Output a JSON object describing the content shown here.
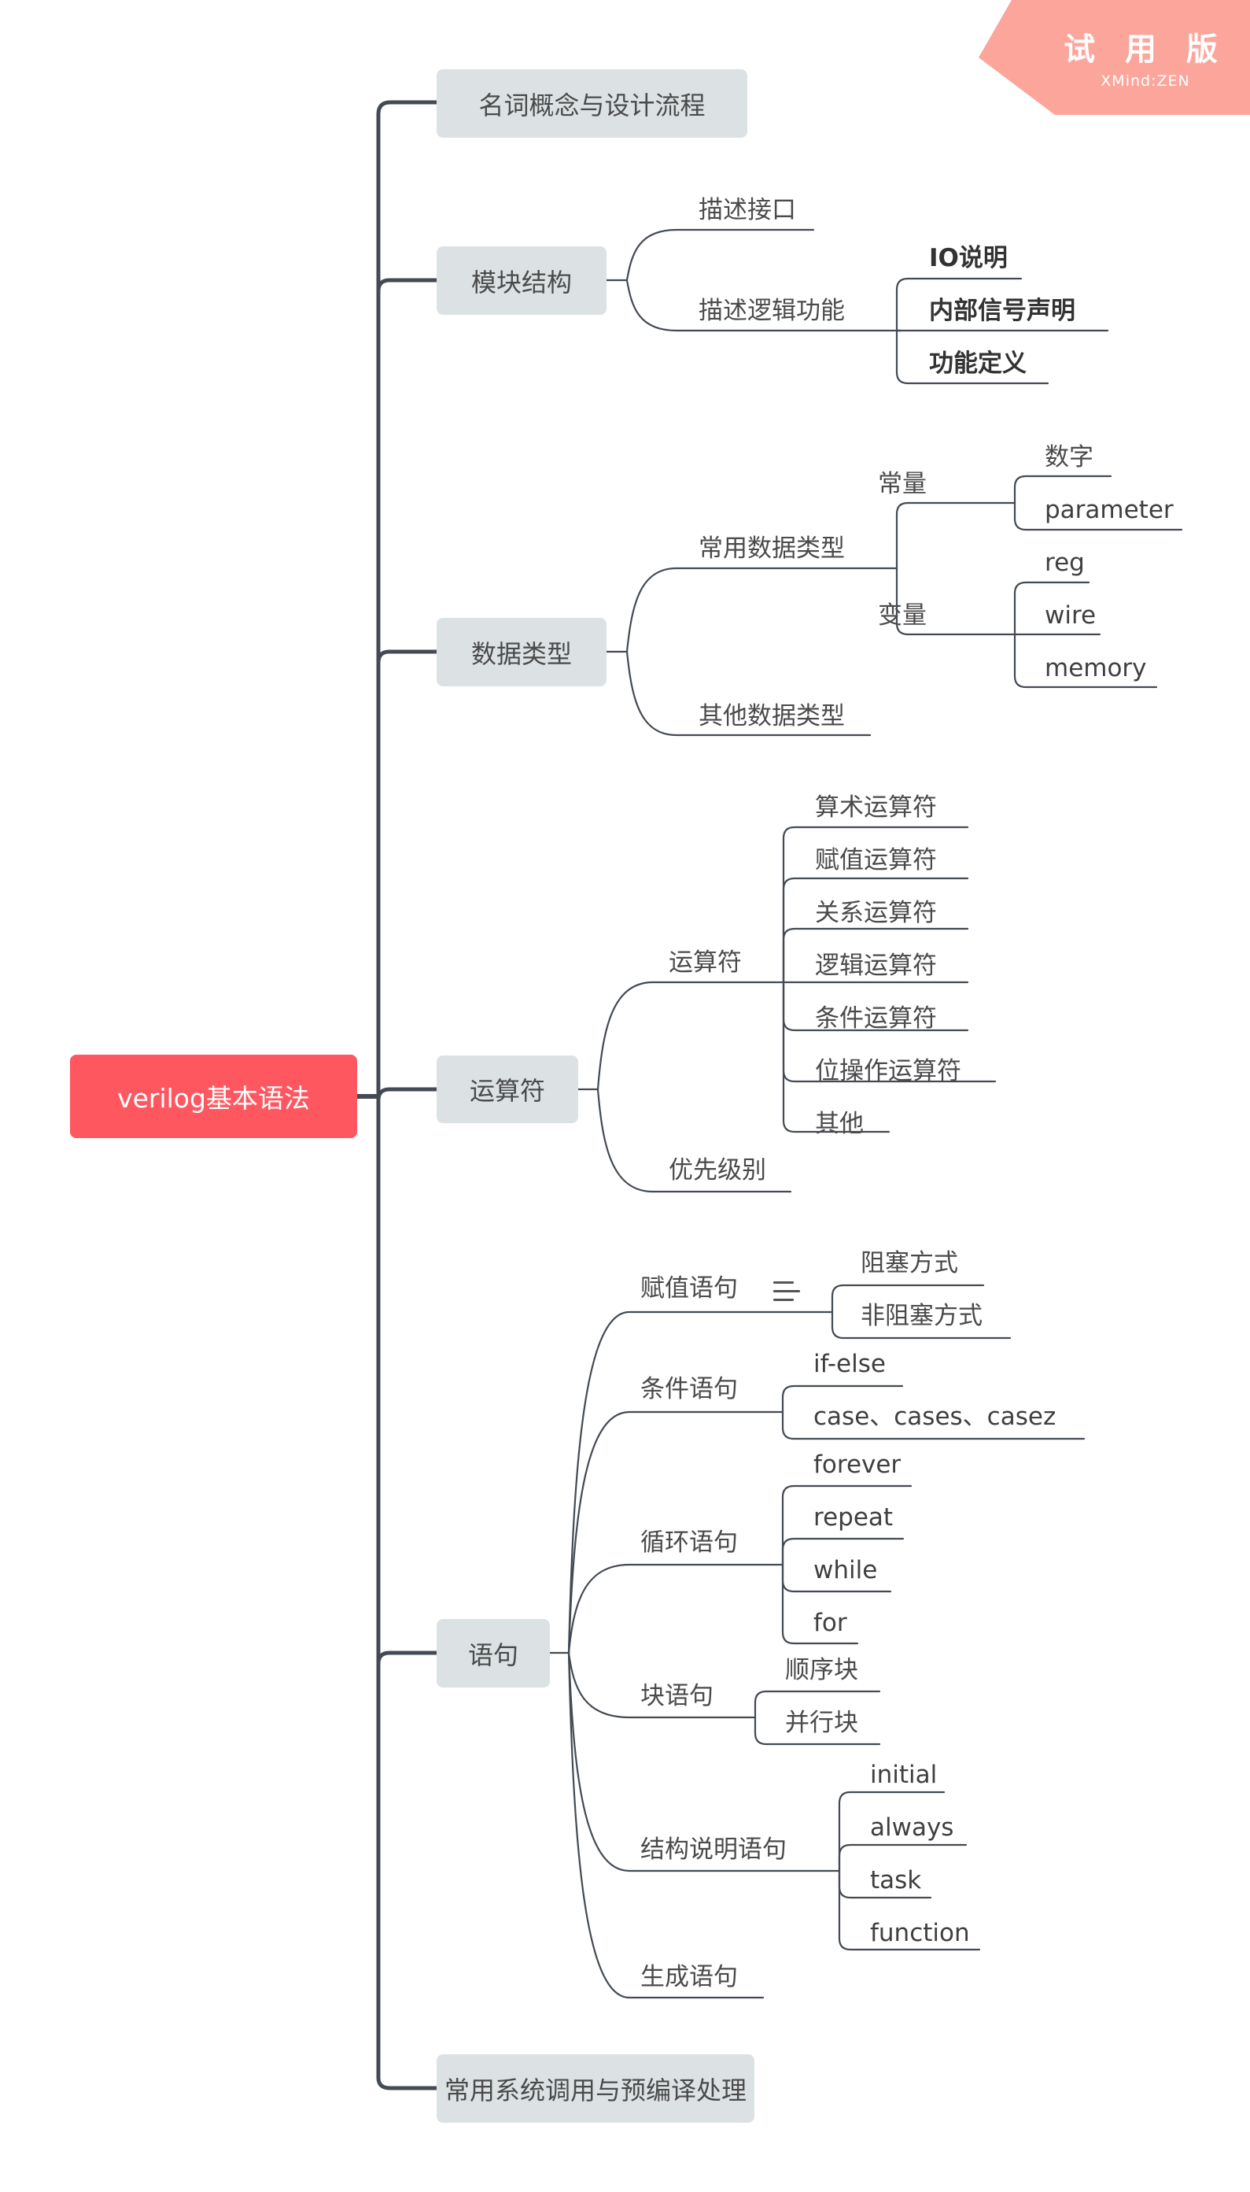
{
  "watermark": {
    "title": "试 用 版",
    "subtitle": "XMind:ZEN",
    "color": "#FCA59A"
  },
  "colors": {
    "root": "#FF5760",
    "topic": "#DCE2E4",
    "line": "#434A53",
    "text": "#4A4A4A"
  },
  "root": {
    "label": "verilog基本语法"
  },
  "topics": [
    {
      "label": "名词概念与设计流程"
    },
    {
      "label": "模块结构",
      "children": [
        {
          "label": "描述接口"
        },
        {
          "label": "描述逻辑功能",
          "children": [
            {
              "label": "IO说明"
            },
            {
              "label": "内部信号声明"
            },
            {
              "label": "功能定义"
            }
          ]
        }
      ]
    },
    {
      "label": "数据类型",
      "children": [
        {
          "label": "常用数据类型",
          "children": [
            {
              "label": "常量",
              "children": [
                {
                  "label": "数字"
                },
                {
                  "label": "parameter"
                }
              ]
            },
            {
              "label": "变量",
              "children": [
                {
                  "label": "reg"
                },
                {
                  "label": "wire"
                },
                {
                  "label": "memory"
                }
              ]
            }
          ]
        },
        {
          "label": "其他数据类型"
        }
      ]
    },
    {
      "label": "运算符",
      "children": [
        {
          "label": "运算符",
          "children": [
            {
              "label": "算术运算符"
            },
            {
              "label": "赋值运算符"
            },
            {
              "label": "关系运算符"
            },
            {
              "label": "逻辑运算符"
            },
            {
              "label": "条件运算符"
            },
            {
              "label": "位操作运算符"
            },
            {
              "label": "其他"
            }
          ]
        },
        {
          "label": "优先级别"
        }
      ]
    },
    {
      "label": "语句",
      "children": [
        {
          "label": "赋值语句",
          "note_icon": "notes-icon",
          "children": [
            {
              "label": "阻塞方式"
            },
            {
              "label": "非阻塞方式"
            }
          ]
        },
        {
          "label": "条件语句",
          "children": [
            {
              "label": "if-else"
            },
            {
              "label": "case、cases、casez"
            }
          ]
        },
        {
          "label": "循环语句",
          "children": [
            {
              "label": "forever"
            },
            {
              "label": "repeat"
            },
            {
              "label": "while"
            },
            {
              "label": "for"
            }
          ]
        },
        {
          "label": "块语句",
          "children": [
            {
              "label": "顺序块"
            },
            {
              "label": "并行块"
            }
          ]
        },
        {
          "label": "结构说明语句",
          "children": [
            {
              "label": "initial"
            },
            {
              "label": "always"
            },
            {
              "label": "task"
            },
            {
              "label": "function"
            }
          ]
        },
        {
          "label": "生成语句"
        }
      ]
    },
    {
      "label": "常用系统调用与预编译处理"
    }
  ]
}
